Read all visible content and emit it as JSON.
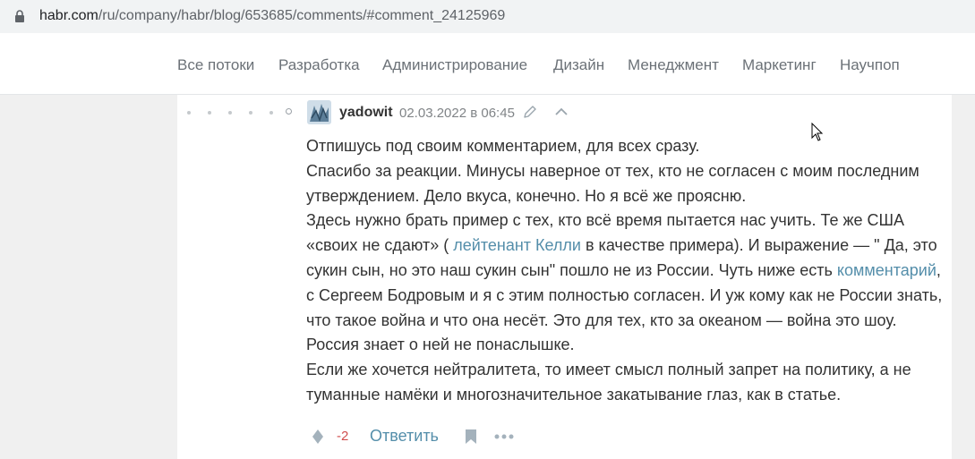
{
  "browser": {
    "url_host": "habr.com",
    "url_path": "/ru/company/habr/blog/653685/comments/#comment_24125969"
  },
  "nav": {
    "items": [
      "Все потоки",
      "Разработка",
      "Администрирование",
      "Дизайн",
      "Менеджмент",
      "Маркетинг",
      "Научпоп"
    ]
  },
  "comment": {
    "author": "yadowit",
    "timestamp": "02.03.2022 в 06:45",
    "paragraphs": {
      "p1": "Отпишусь под своим комментарием, для всех сразу.",
      "p2": "Спасибо за реакции. Минусы наверное от тех, кто не согласен с моим последним утверждением. Дело вкуса, конечно. Но я всё же проясню.",
      "p3_before_link1": "Здесь нужно брать пример с тех, кто всё время пытается нас учить. Те же США «своих не сдают» ( ",
      "p3_link1": "лейтенант Келли",
      "p3_between": " в качестве примера). И выражение — \" Да, это сукин сын, но это наш сукин сын\" пошло не из России. Чуть ниже есть ",
      "p3_link2": "комментарий",
      "p3_after": ", с Сергеем Бодровым и я с этим полностью согласен. И уж кому как не России знать, что такое война и что она несёт. Это для тех, кто за океаном — война это шоу. Россия знает о ней не понаслышке.",
      "p4": "Если же хочется нейтралитета, то имеет смысл полный запрет на политику, а не туманные намёки и многозначительное закатывание глаз, как в статье."
    },
    "score": "-2",
    "reply_label": "Ответить"
  },
  "icons": {
    "lock": "lock-icon",
    "edit": "pencil-icon",
    "collapse": "chevron-up-icon",
    "vote": "diamond-vote-icon",
    "bookmark": "bookmark-icon",
    "more": "more-dots-icon",
    "cursor": "mouse-pointer-icon"
  },
  "colors": {
    "link": "#548eaa",
    "negative_score": "#d04e4e",
    "nav_text": "#6b7177",
    "page_background": "#f0f0f0"
  }
}
